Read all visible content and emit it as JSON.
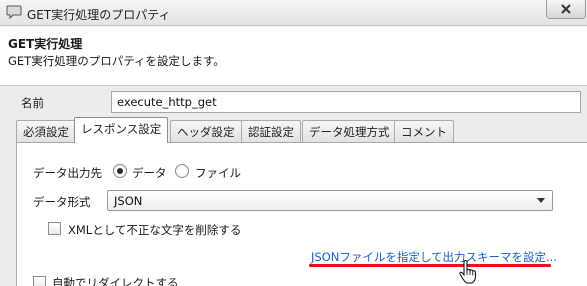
{
  "window": {
    "title": "GET実行処理のプロパティ"
  },
  "header": {
    "title": "GET実行処理",
    "description": "GET実行処理のプロパティを設定します。"
  },
  "name_field": {
    "label": "名前",
    "value": "execute_http_get"
  },
  "tabs": [
    {
      "label": "必須設定",
      "active": false
    },
    {
      "label": "レスポンス設定",
      "active": true
    },
    {
      "label": "ヘッダ設定",
      "active": false
    },
    {
      "label": "認証設定",
      "active": false
    },
    {
      "label": "データ処理方式",
      "active": false
    },
    {
      "label": "コメント",
      "active": false
    }
  ],
  "response": {
    "output_label": "データ出力先",
    "output_options": [
      {
        "label": "データ",
        "selected": true
      },
      {
        "label": "ファイル",
        "selected": false
      }
    ],
    "format_label": "データ形式",
    "format_value": "JSON",
    "remove_invalid_xml_label": "XMLとして不正な文字を削除する",
    "remove_invalid_xml_checked": false,
    "schema_link": "JSONファイルを指定して出力スキーマを設定...",
    "auto_redirect_label": "自動でリダイレクトする",
    "auto_redirect_checked": false
  },
  "colors": {
    "link": "#1a5fc8",
    "highlight": "#e0141c"
  }
}
